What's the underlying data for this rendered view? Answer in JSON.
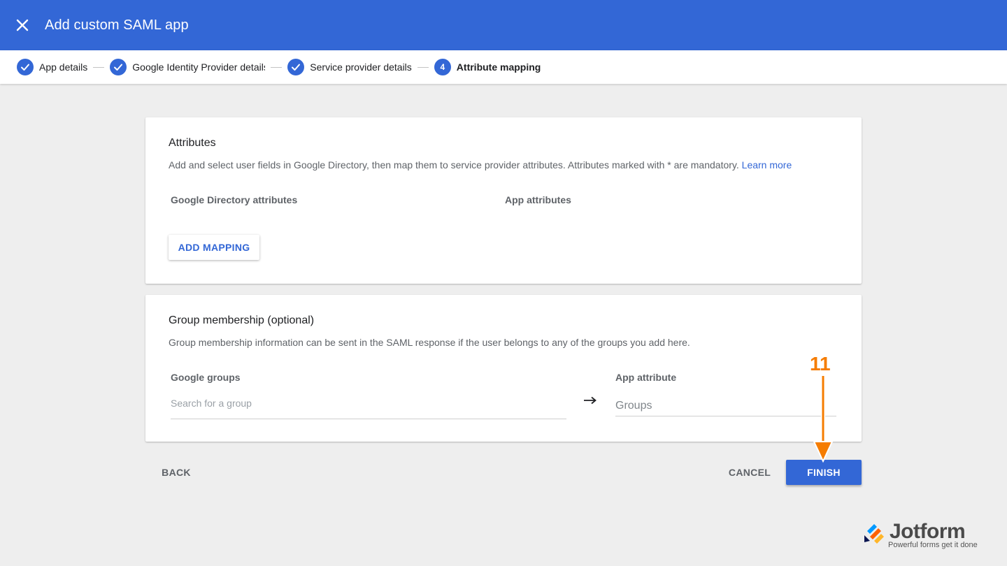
{
  "header": {
    "title": "Add custom SAML app",
    "close_icon": "close-icon"
  },
  "stepper": {
    "steps": [
      {
        "label": "App details",
        "state": "done"
      },
      {
        "label": "Google Identity Provider details",
        "state": "done"
      },
      {
        "label": "Service provider details",
        "state": "done"
      },
      {
        "label": "Attribute mapping",
        "state": "active",
        "number": "4"
      }
    ]
  },
  "attributes_card": {
    "title": "Attributes",
    "description": "Add and select user fields in Google Directory, then map them to service provider attributes. Attributes marked with * are mandatory.",
    "learn_more": "Learn more",
    "col_google": "Google Directory attributes",
    "col_app": "App attributes",
    "add_mapping": "ADD MAPPING"
  },
  "group_card": {
    "title": "Group membership (optional)",
    "description": "Group membership information can be sent in the SAML response if the user belongs to any of the groups you add here.",
    "col_groups": "Google groups",
    "col_app_attr": "App attribute",
    "search_placeholder": "Search for a group",
    "groups_placeholder": "Groups",
    "arrow_icon": "arrow-right-icon"
  },
  "footer": {
    "back": "BACK",
    "cancel": "CANCEL",
    "finish": "FINISH"
  },
  "annotation": {
    "step_number": "11",
    "color": "#f57c00"
  },
  "watermark": {
    "brand": "Jotform",
    "tagline": "Powerful forms get it done"
  },
  "colors": {
    "primary": "#3367d6",
    "background": "#eeeeee"
  }
}
